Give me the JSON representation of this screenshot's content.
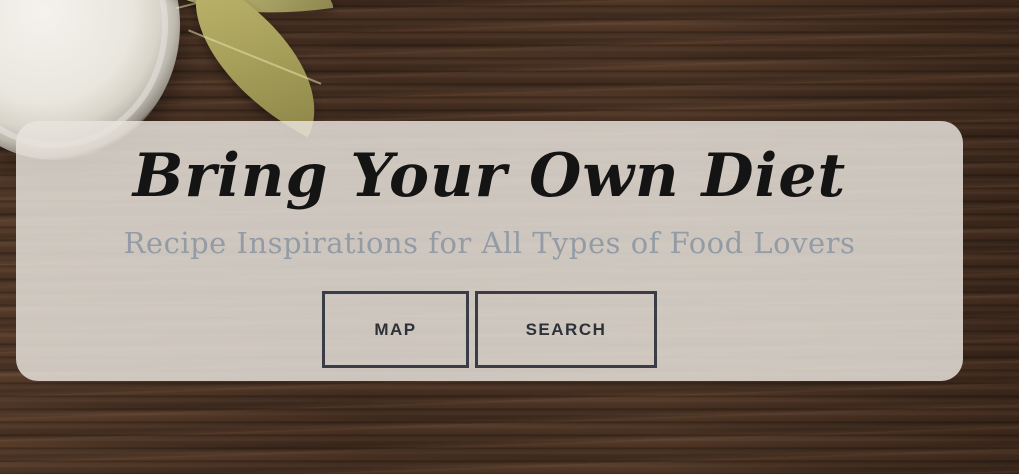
{
  "hero": {
    "title": "Bring Your Own Diet",
    "subtitle": "Recipe Inspirations for All Types of Food Lovers",
    "background": "wood-table-with-salt-jar-and-bay-leaves"
  },
  "buttons": {
    "map_label": "MAP",
    "search_label": "SEARCH"
  },
  "colors": {
    "title": "#141414",
    "subtitle": "#939ca6",
    "button_border": "#3a3d45",
    "card_background": "#e8e4dc"
  }
}
